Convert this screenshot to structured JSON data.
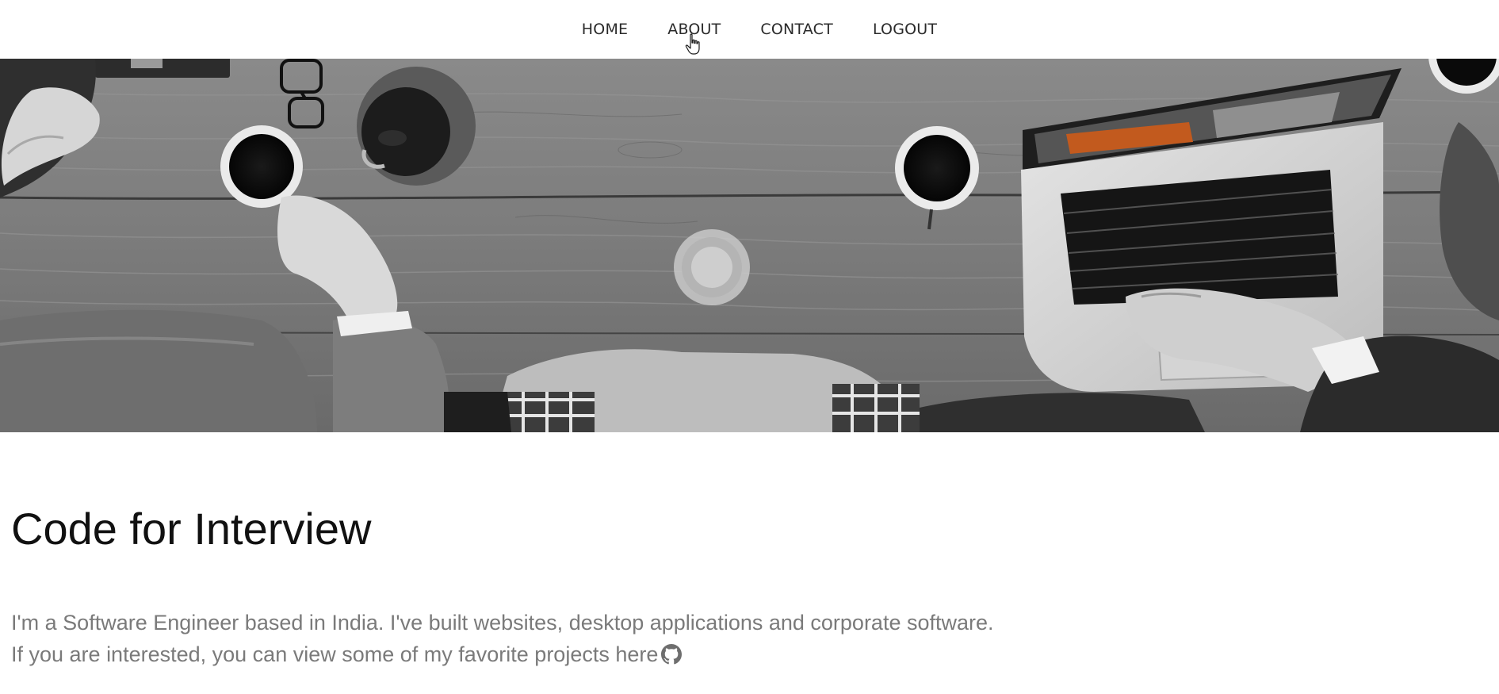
{
  "nav": {
    "items": [
      {
        "id": "home",
        "label": "HOME"
      },
      {
        "id": "about",
        "label": "ABOUT"
      },
      {
        "id": "contact",
        "label": "CONTACT"
      },
      {
        "id": "logout",
        "label": "LOGOUT"
      }
    ],
    "hovered": "about"
  },
  "hero": {
    "image": "black-and-white-desk-with-coffee-cups-and-laptop"
  },
  "main": {
    "title": "Code for Interview",
    "bio_line1": "I'm a Software Engineer based in India. I've built websites, desktop applications and corporate software.",
    "bio_line2": "If you are interested, you can view some of my favorite projects here",
    "github_icon": "github-icon"
  }
}
